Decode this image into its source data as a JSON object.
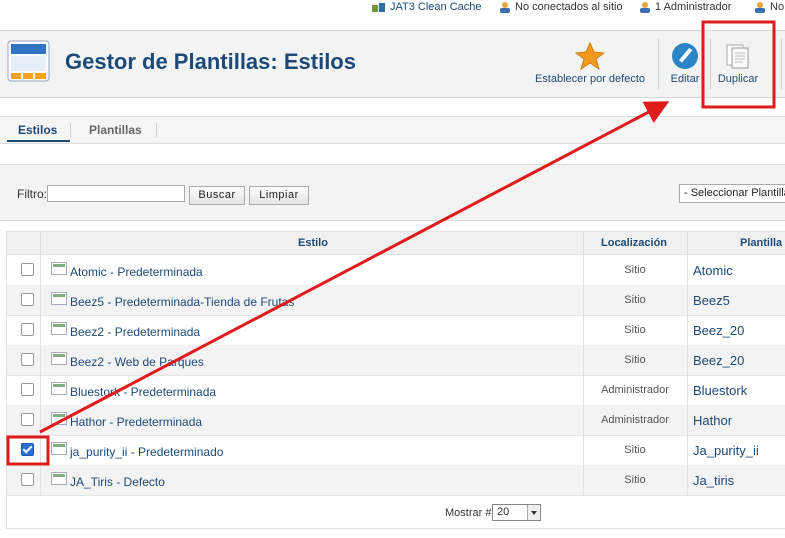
{
  "status_bar": {
    "cache_label": "JAT3 Clean Cache",
    "not_connected_label": "No conectados al sitio",
    "admin_label": "1 Administrador",
    "more_label": "No h"
  },
  "header": {
    "title": "Gestor de Plantillas: Estilos",
    "toolbar": {
      "set_default_label": "Establecer por defecto",
      "edit_label": "Editar",
      "duplicate_label": "Duplicar"
    }
  },
  "tabs": [
    {
      "label": "Estilos",
      "active": true
    },
    {
      "label": "Plantillas",
      "active": false
    }
  ],
  "filter": {
    "label": "Filtro:",
    "value": "",
    "search_button": "Buscar",
    "clear_button": "Limpiar",
    "template_select": "- Seleccionar Plantilla"
  },
  "table": {
    "headers": {
      "style": "Estilo",
      "location": "Localización",
      "template": "Plantilla"
    },
    "rows": [
      {
        "name": "Atomic - Predeterminada",
        "location": "Sitio",
        "template": "Atomic",
        "checked": false
      },
      {
        "name": "Beez5 - Predeterminada-Tienda de Frutas",
        "location": "Sitio",
        "template": "Beez5",
        "checked": false
      },
      {
        "name": "Beez2 - Predeterminada",
        "location": "Sitio",
        "template": "Beez_20",
        "checked": false
      },
      {
        "name": "Beez2 - Web de Parques",
        "location": "Sitio",
        "template": "Beez_20",
        "checked": false
      },
      {
        "name": "Bluestork - Predeterminada",
        "location": "Administrador",
        "template": "Bluestork",
        "checked": false
      },
      {
        "name": "Hathor - Predeterminada",
        "location": "Administrador",
        "template": "Hathor",
        "checked": false
      },
      {
        "name": "ja_purity_ii - Predeterminado",
        "location": "Sitio",
        "template": "Ja_purity_ii",
        "checked": true
      },
      {
        "name": "JA_Tiris - Defecto",
        "location": "Sitio",
        "template": "Ja_tiris",
        "checked": false
      }
    ],
    "footer": {
      "show_label": "Mostrar #",
      "show_value": "20"
    }
  },
  "colors": {
    "annotation": "#e01b1b",
    "link": "#1b4a79"
  }
}
